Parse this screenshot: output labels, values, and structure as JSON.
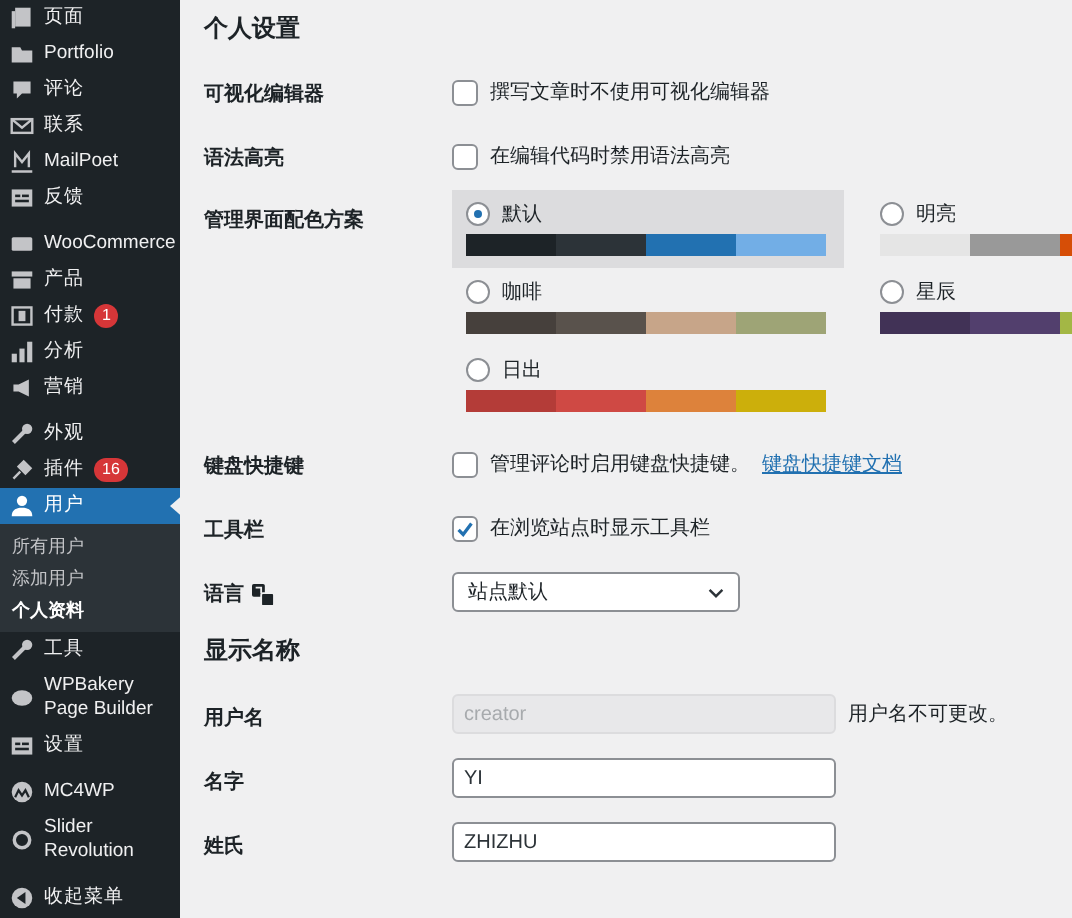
{
  "sidebar": {
    "groups": [
      [
        {
          "label": "页面",
          "selected": false
        },
        {
          "label": "Portfolio",
          "selected": false
        },
        {
          "label": "评论",
          "selected": false
        },
        {
          "label": "联系",
          "selected": false
        },
        {
          "label": "MailPoet",
          "selected": false
        },
        {
          "label": "反馈",
          "selected": false
        }
      ],
      [
        {
          "label": "WooCommerce",
          "selected": false
        },
        {
          "label": "产品",
          "selected": false
        },
        {
          "label": "付款",
          "badge": "1",
          "selected": false
        },
        {
          "label": "分析",
          "selected": false
        },
        {
          "label": "营销",
          "selected": false
        }
      ],
      [
        {
          "label": "外观",
          "selected": false
        },
        {
          "label": "插件",
          "badge": "16",
          "selected": false
        },
        {
          "label": "用户",
          "selected": true,
          "children": [
            {
              "label": "所有用户",
              "selected": false
            },
            {
              "label": "添加用户",
              "selected": false
            },
            {
              "label": "个人资料",
              "selected": true
            }
          ]
        },
        {
          "label": "工具",
          "selected": false
        },
        {
          "label": "WPBakery Page Builder",
          "selected": false
        },
        {
          "label": "设置",
          "selected": false
        }
      ],
      [
        {
          "label": "MC4WP",
          "selected": false
        },
        {
          "label": "Slider Revolution",
          "selected": false
        }
      ]
    ],
    "collapse_label": "收起菜单"
  },
  "sections": [
    {
      "title": "个人设置",
      "rows": [
        {
          "kind": "checkbox",
          "label": "可视化编辑器",
          "text": "撰写文章时不使用可视化编辑器",
          "checked": false
        },
        {
          "kind": "checkbox",
          "label": "语法高亮",
          "text": "在编辑代码时禁用语法高亮",
          "checked": false
        },
        {
          "kind": "schemes",
          "label": "管理界面配色方案",
          "options": [
            {
              "name": "默认",
              "selected": true,
              "colors": [
                {
                  "color": "#1d2327"
                },
                {
                  "color": "#2c3338"
                },
                {
                  "color": "#2271b1"
                },
                {
                  "color": "#72aee6"
                }
              ]
            },
            {
              "name": "明亮",
              "selected": false,
              "colors": [
                {
                  "color": "#e5e5e5"
                },
                {
                  "color": "#999999"
                },
                {
                  "color": "#d64e07"
                }
              ]
            },
            {
              "name": "咖啡",
              "selected": false,
              "colors": [
                {
                  "color": "#46403c"
                },
                {
                  "color": "#59524c"
                },
                {
                  "color": "#c7a589"
                },
                {
                  "color": "#9ea476"
                }
              ]
            },
            {
              "name": "星辰",
              "selected": false,
              "colors": [
                {
                  "color": "#413256"
                },
                {
                  "color": "#523f6d"
                },
                {
                  "color": "#a3b745"
                }
              ]
            },
            {
              "name": "日出",
              "selected": false,
              "colors": [
                {
                  "color": "#b43c38"
                },
                {
                  "color": "#cf4944"
                },
                {
                  "color": "#dd823b"
                },
                {
                  "color": "#ccaf0b"
                }
              ]
            }
          ]
        },
        {
          "kind": "checkbox",
          "label": "键盘快捷键",
          "text": "管理评论时启用键盘快捷键。",
          "link": "键盘快捷键文档",
          "checked": false
        },
        {
          "kind": "checkbox",
          "label": "工具栏",
          "text": "在浏览站点时显示工具栏",
          "checked": true
        },
        {
          "kind": "select",
          "label": "语言",
          "value": "站点默认"
        }
      ]
    },
    {
      "title": "显示名称",
      "rows": [
        {
          "kind": "input",
          "label": "用户名",
          "value": "creator",
          "disabled": true,
          "note": "用户名不可更改。"
        },
        {
          "kind": "input",
          "label": "名字",
          "value": "YI",
          "disabled": false
        },
        {
          "kind": "input",
          "label": "姓氏",
          "value": "ZHIZHU",
          "disabled": false
        }
      ]
    }
  ]
}
